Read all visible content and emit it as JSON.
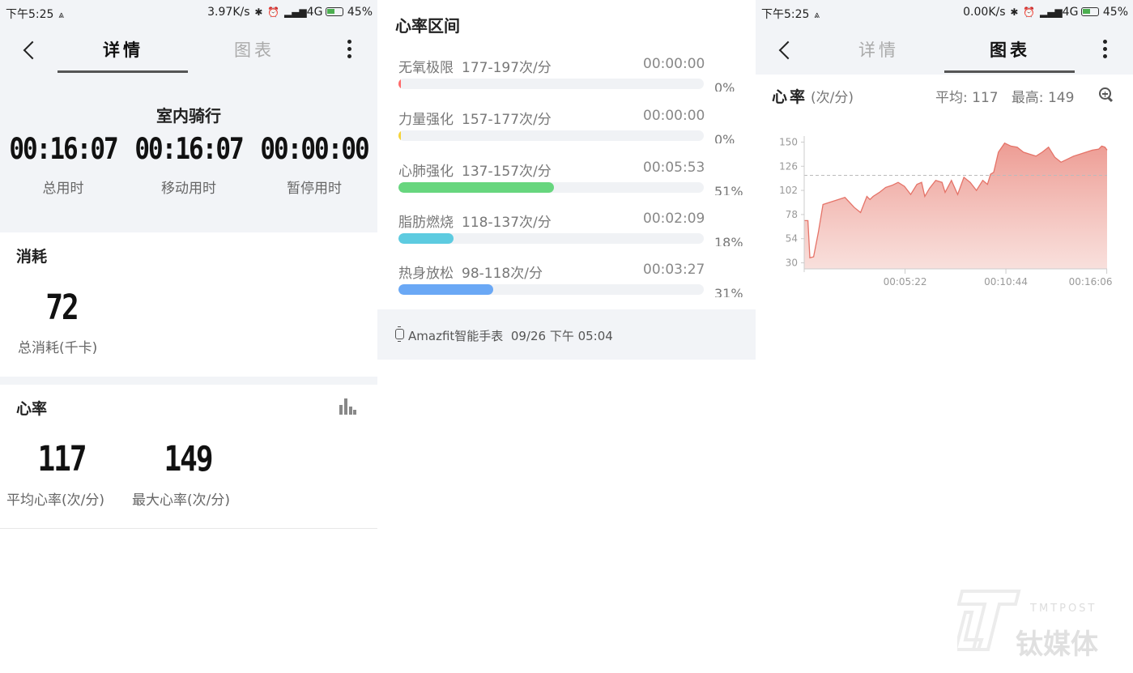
{
  "panel1": {
    "status": {
      "time": "下午5:25",
      "speed": "3.97K/s",
      "network": "4G",
      "battery": "45%"
    },
    "tabs": {
      "details": "详情",
      "chart": "图表"
    },
    "activity_title": "室内骑行",
    "times": [
      {
        "value": "00:16:07",
        "label": "总用时"
      },
      {
        "value": "00:16:07",
        "label": "移动用时"
      },
      {
        "value": "00:00:00",
        "label": "暂停用时"
      }
    ],
    "consumption": {
      "title": "消耗",
      "value": "72",
      "label": "总消耗(千卡)"
    },
    "heart_rate": {
      "title": "心率",
      "avg": {
        "value": "117",
        "label": "平均心率(次/分)"
      },
      "max": {
        "value": "149",
        "label": "最大心率(次/分)"
      }
    }
  },
  "panel2": {
    "title": "心率区间",
    "zones": [
      {
        "name": "无氧极限",
        "range": "177-197次/分",
        "time": "00:00:00",
        "percent": "0%",
        "fraction": 0.0,
        "color": "#ff6b6b"
      },
      {
        "name": "力量强化",
        "range": "157-177次/分",
        "time": "00:00:00",
        "percent": "0%",
        "fraction": 0.0,
        "color": "#f5d33a"
      },
      {
        "name": "心肺强化",
        "range": "137-157次/分",
        "time": "00:05:53",
        "percent": "51%",
        "fraction": 0.51,
        "color": "#67d67e"
      },
      {
        "name": "脂肪燃烧",
        "range": "118-137次/分",
        "time": "00:02:09",
        "percent": "18%",
        "fraction": 0.18,
        "color": "#5dcbe0"
      },
      {
        "name": "热身放松",
        "range": "98-118次/分",
        "time": "00:03:27",
        "percent": "31%",
        "fraction": 0.31,
        "color": "#6aa8f5"
      }
    ],
    "device": "Amazfit智能手表",
    "record_time": "09/26 下午 05:04"
  },
  "panel3": {
    "status": {
      "time": "下午5:25",
      "speed": "0.00K/s",
      "network": "4G",
      "battery": "45%"
    },
    "tabs": {
      "details": "详情",
      "chart": "图表"
    },
    "chart_title": "心率",
    "chart_unit": "(次/分)",
    "avg_text": "平均: 117",
    "max_text": "最高: 149"
  },
  "chart_data": {
    "type": "area",
    "title": "心率",
    "ylabel": "(次/分)",
    "yticks": [
      30,
      54,
      78,
      102,
      126,
      150
    ],
    "ylim": [
      24,
      156
    ],
    "xlim": [
      0,
      967
    ],
    "xticks": [
      {
        "t": 322,
        "label": "00:05:22"
      },
      {
        "t": 644,
        "label": "00:10:44"
      },
      {
        "t": 966,
        "label": "00:16:06"
      }
    ],
    "average_line": 117,
    "color": "#e57368",
    "x": [
      0,
      12,
      18,
      30,
      45,
      60,
      80,
      100,
      130,
      160,
      180,
      200,
      210,
      220,
      240,
      260,
      280,
      300,
      320,
      340,
      360,
      375,
      385,
      400,
      420,
      440,
      450,
      470,
      490,
      510,
      530,
      550,
      570,
      585,
      595,
      605,
      620,
      640,
      660,
      680,
      700,
      720,
      740,
      760,
      780,
      800,
      820,
      840,
      860,
      880,
      900,
      920,
      940,
      950,
      960,
      967
    ],
    "values": [
      72,
      72,
      35,
      36,
      60,
      88,
      90,
      92,
      95,
      85,
      80,
      96,
      93,
      96,
      100,
      105,
      107,
      110,
      106,
      98,
      108,
      110,
      96,
      104,
      112,
      110,
      100,
      112,
      98,
      115,
      110,
      102,
      112,
      108,
      118,
      120,
      140,
      149,
      146,
      145,
      140,
      138,
      136,
      140,
      145,
      135,
      130,
      133,
      136,
      138,
      140,
      142,
      143,
      146,
      145,
      142
    ]
  }
}
